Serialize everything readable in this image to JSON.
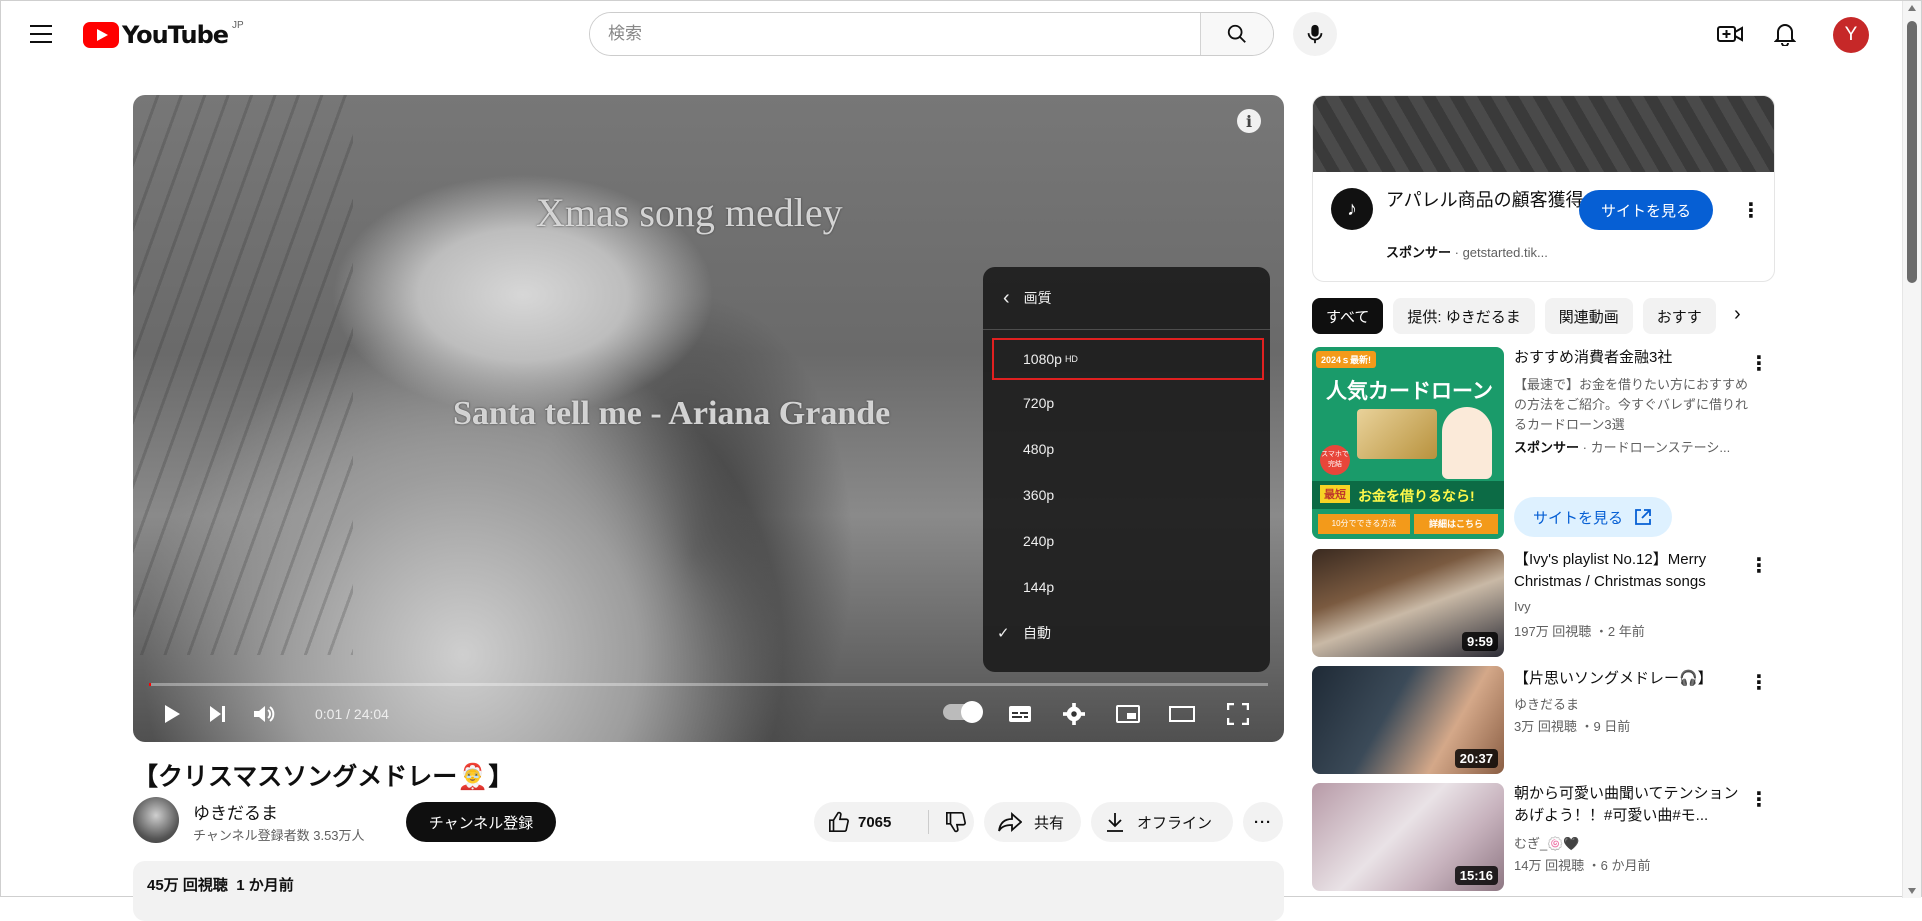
{
  "header": {
    "logo_text": "YouTube",
    "country_code": "JP",
    "search_placeholder": "検索",
    "avatar_letter": "Y"
  },
  "player": {
    "overlay_title": "Xmas song medley",
    "overlay_song": "Santa tell me - Ariana Grande",
    "time_current": "0:01",
    "time_total": "24:04",
    "time_display": "0:01 / 24:04",
    "progress_fraction": 0.001,
    "quality_menu": {
      "header": "画質",
      "options": [
        "1080p",
        "720p",
        "480p",
        "360p",
        "240p",
        "144p",
        "自動"
      ],
      "hd_badge": "HD",
      "checked_option": "自動",
      "highlighted_option": "1080p"
    }
  },
  "video": {
    "title": "【クリスマスソングメドレー🤶】",
    "channel_name": "ゆきだるま",
    "subscribers": "チャンネル登録者数 3.53万人",
    "subscribe_label": "チャンネル登録",
    "like_count": "7065",
    "share_label": "共有",
    "offline_label": "オフライン",
    "views": "45万 回視聴",
    "age": "1 か月前"
  },
  "ad": {
    "logo_glyph": "♪",
    "title": "アパレル商品の顧客獲得",
    "sponsor_label": "スポンサー",
    "domain": "getstarted.tik...",
    "visit_label": "サイトを見る"
  },
  "chips": [
    "すべて",
    "提供: ゆきだるま",
    "関連動画",
    "おすす"
  ],
  "recommendations": [
    {
      "type": "ad",
      "title": "おすすめ消費者金融3社",
      "description": "【最速で】お金を借りたい方におすすめの方法をご紹介。今すぐバレずに借りれるカードローン3選",
      "sponsor_label": "スポンサー",
      "sponsor_domain": "カードローンステーシ...",
      "visit_label": "サイトを見る",
      "thumb_badge": "2024ｓ最新!",
      "thumb_headline": "人気カードローン",
      "thumb_bottom": "お金を借りるなら!",
      "thumb_short": "最短",
      "thumb_side": "スマホで完結",
      "thumb_footer_left": "10分でできる方法",
      "thumb_footer_right": "詳細はこちら"
    },
    {
      "type": "video",
      "title": "【Ivy's playlist No.12】Merry Christmas / Christmas songs",
      "channel": "Ivy",
      "meta": "197万 回視聴 ・2 年前",
      "duration": "9:59"
    },
    {
      "type": "video",
      "title": "【片思いソングメドレー🎧】",
      "channel": "ゆきだるま",
      "meta": "3万 回視聴 ・9 日前",
      "duration": "20:37"
    },
    {
      "type": "video",
      "title": "朝から可愛い曲聞いてテンションあげよう！！#可愛い曲#モ...",
      "channel": "むぎ_🍥🖤",
      "meta": "14万 回視聴 ・6 か月前",
      "duration": "15:16"
    }
  ]
}
